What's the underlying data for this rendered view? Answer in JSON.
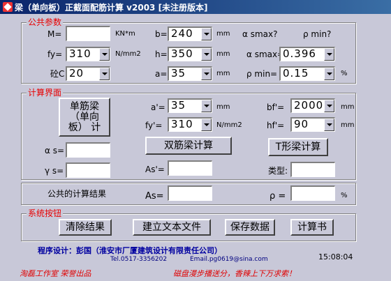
{
  "window": {
    "title": "梁（单向板）正截面配筋计算 v2003 [未注册版本]",
    "icon": "app-icon"
  },
  "colors": {
    "legend": "#e80000",
    "footer_red": "#e00000",
    "footer_blue": "#0000a0"
  },
  "public": {
    "legend": "公共参数",
    "m_label": "M=",
    "m_value": "",
    "m_unit": "KN*m",
    "b_label": "b=",
    "b_value": "240",
    "b_unit": "mm",
    "fy_label": "fy=",
    "fy_value": "310",
    "fy_unit": "N/mm2",
    "h_label": "h=",
    "h_value": "350",
    "h_unit": "mm",
    "c_label": "砼C",
    "c_value": "20",
    "a_label": "a=",
    "a_value": "35",
    "a_unit": "mm",
    "asmax_q_label": "α smax?",
    "rhomin_q_label": "ρ min?",
    "asmax_label": "α smax=",
    "asmax_value": "0.396",
    "rhomin_label": "ρ min=",
    "rhomin_value": "0.15",
    "rhomin_unit": "%"
  },
  "calc": {
    "legend": "计算界面",
    "single_button": "单筋梁\n（单向\n板） 计",
    "as_label": "α s=",
    "as_value": "",
    "gs_label": "γ s=",
    "gs_value": "",
    "a2_label": "a'=",
    "a2_value": "35",
    "a2_unit": "mm",
    "fy2_label": "fy'=",
    "fy2_value": "310",
    "fy2_unit": "N/mm2",
    "double_button": "双筋梁计算",
    "as2_label": "As'=",
    "as2_value": "",
    "bf_label": "bf'=",
    "bf_value": "2000",
    "bf_unit": "mm",
    "hf_label": "hf'=",
    "hf_value": "90",
    "hf_unit": "mm",
    "t_button": "T形梁计算",
    "type_label": "类型:",
    "type_value": ""
  },
  "result": {
    "label": "公共的计算结果",
    "As_label": "As=",
    "As_value": "",
    "rho_label": "ρ =",
    "rho_value": "",
    "rho_unit": "%"
  },
  "system": {
    "legend": "系统按钮",
    "clear": "清除结果",
    "text": "建立文本文件",
    "save": "保存数据",
    "calc": "计算书"
  },
  "footer": {
    "designer": "程序设计：彭国（淮安市厂厦建筑设计有限责任公司）",
    "tel": "Tel.0517-3356202",
    "email": "Email.pg0619@sina.com",
    "time": "15:08:04",
    "left_slogan": "淘磊工作室  荣誉出品",
    "right_slogan": "磁盘漫步播送分，香辣上下万求索！"
  }
}
